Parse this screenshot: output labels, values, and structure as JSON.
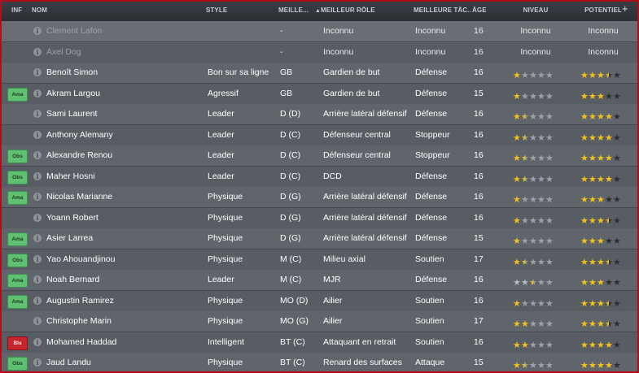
{
  "headers": {
    "inf": "INF",
    "nom": "NOM",
    "style": "STYLE",
    "meilleur_poste": "MEILLE...",
    "meilleur_role": "MEILLEUR RÔLE",
    "meilleure_tache": "MEILLEURE TÂC...",
    "age": "ÂGE",
    "niveau": "NIVEAU",
    "potentiel": "POTENTIEL",
    "add": "+"
  },
  "colors": {
    "accent_border": "#b00f17",
    "star": "#f2c21a",
    "badge_green": "#5fbf73",
    "badge_red": "#c4262b"
  },
  "players": [
    {
      "inf": "",
      "nom": "Clement Lafon",
      "style": "",
      "poste": "-",
      "role": "Inconnu",
      "tache": "Inconnu",
      "age": "16",
      "niveau_text": "Inconnu",
      "potentiel_text": "Inconnu",
      "niveau": null,
      "potentiel": null,
      "dimmed": true
    },
    {
      "inf": "",
      "nom": "Axel Dog",
      "style": "",
      "poste": "-",
      "role": "Inconnu",
      "tache": "Inconnu",
      "age": "16",
      "niveau_text": "Inconnu",
      "potentiel_text": "Inconnu",
      "niveau": null,
      "potentiel": null,
      "dimmed": true
    },
    {
      "inf": "",
      "nom": "Benoît Simon",
      "style": "Bon sur sa ligne",
      "poste": "GB",
      "role": "Gardien de but",
      "tache": "Défense",
      "age": "16",
      "niveau": 1,
      "potentiel": 3.5
    },
    {
      "inf": "Ama",
      "inf_color": "green",
      "nom": "Akram Largou",
      "style": "Agressif",
      "poste": "GB",
      "role": "Gardien de but",
      "tache": "Défense",
      "age": "15",
      "niveau": 1,
      "potentiel": 3
    },
    {
      "inf": "",
      "nom": "Sami Laurent",
      "style": "Leader",
      "poste": "D (D)",
      "role": "Arrière latéral défensif",
      "tache": "Défense",
      "age": "16",
      "niveau": 1.5,
      "potentiel": 4
    },
    {
      "inf": "",
      "nom": "Anthony Alemany",
      "style": "Leader",
      "poste": "D (C)",
      "role": "Défenseur central",
      "tache": "Stoppeur",
      "age": "16",
      "niveau": 1.5,
      "potentiel": 4
    },
    {
      "inf": "Obs",
      "inf_color": "green",
      "nom": "Alexandre Renou",
      "style": "Leader",
      "poste": "D (C)",
      "role": "Défenseur central",
      "tache": "Stoppeur",
      "age": "16",
      "niveau": 1.5,
      "potentiel": 4
    },
    {
      "inf": "Obs",
      "inf_color": "green",
      "nom": "Maher Hosni",
      "style": "Leader",
      "poste": "D (C)",
      "role": "DCD",
      "tache": "Défense",
      "age": "16",
      "niveau": 1.5,
      "potentiel": 4
    },
    {
      "inf": "Ama",
      "inf_color": "green",
      "nom": "Nicolas Marianne",
      "style": "Physique",
      "poste": "D (G)",
      "role": "Arrière latéral défensif",
      "tache": "Défense",
      "age": "16",
      "niveau": 1,
      "potentiel": 3
    },
    {
      "inf": "",
      "nom": "Yoann Robert",
      "style": "Physique",
      "poste": "D (G)",
      "role": "Arrière latéral défensif",
      "tache": "Défense",
      "age": "16",
      "niveau": 1,
      "potentiel": 3.5
    },
    {
      "inf": "Ama",
      "inf_color": "green",
      "nom": "Asier Larrea",
      "style": "Physique",
      "poste": "D (G)",
      "role": "Arrière latéral défensif",
      "tache": "Défense",
      "age": "15",
      "niveau": 1,
      "potentiel": 3
    },
    {
      "inf": "Obs",
      "inf_color": "green",
      "nom": "Yao Ahouandjinou",
      "style": "Physique",
      "poste": "M (C)",
      "role": "Milieu axial",
      "tache": "Soutien",
      "age": "17",
      "niveau": 1.5,
      "potentiel": 3.5
    },
    {
      "inf": "Ama",
      "inf_color": "green",
      "nom": "Noah Bernard",
      "style": "Leader",
      "poste": "M (C)",
      "role": "MJR",
      "tache": "Défense",
      "age": "16",
      "niveau": 2.5,
      "niveau_style": "silver",
      "potentiel": 3
    },
    {
      "inf": "Ama",
      "inf_color": "green",
      "nom": "Augustin Ramirez",
      "style": "Physique",
      "poste": "MO (D)",
      "role": "Ailier",
      "tache": "Soutien",
      "age": "16",
      "niveau": 1,
      "potentiel": 3.5
    },
    {
      "inf": "",
      "nom": "Christophe Marin",
      "style": "Physique",
      "poste": "MO (G)",
      "role": "Ailier",
      "tache": "Soutien",
      "age": "17",
      "niveau": 2,
      "potentiel": 3.5
    },
    {
      "inf": "Bls",
      "inf_color": "red",
      "nom": "Mohamed Haddad",
      "style": "Intelligent",
      "poste": "BT (C)",
      "role": "Attaquant en retrait",
      "tache": "Soutien",
      "age": "16",
      "niveau": 2,
      "potentiel": 4
    },
    {
      "inf": "Obs",
      "inf_color": "green",
      "nom": "Jaud Landu",
      "style": "Physique",
      "poste": "BT (C)",
      "role": "Renard des surfaces",
      "tache": "Attaque",
      "age": "15",
      "niveau": 1.5,
      "potentiel": 4
    }
  ]
}
